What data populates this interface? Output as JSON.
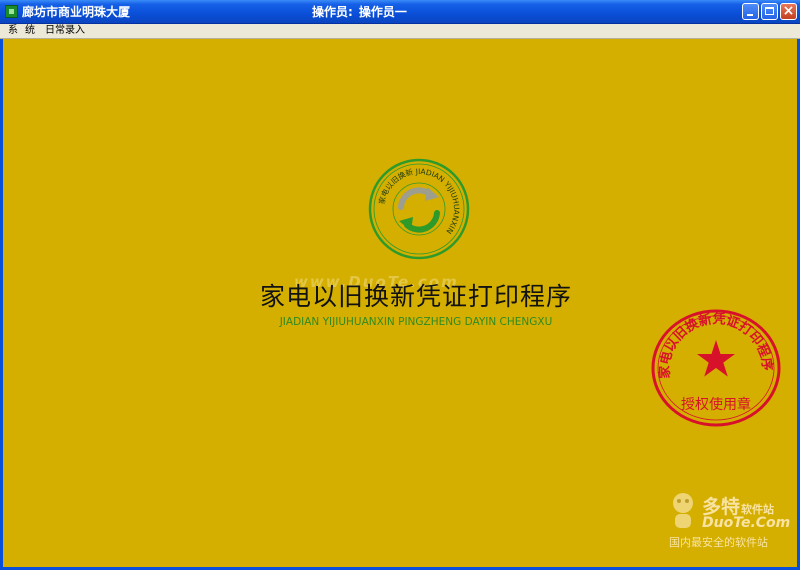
{
  "window": {
    "title": "廊坊市商业明珠大厦",
    "operator_label": "操作员:",
    "operator_name": "操作员一",
    "buttons": [
      "minimize",
      "maximize",
      "close"
    ]
  },
  "menu": {
    "items": [
      {
        "label": "系统"
      },
      {
        "label": "日常录入"
      }
    ]
  },
  "splash": {
    "logo_ring_text": "家电以旧换新 JIADIAN YIJIUHUANXIN",
    "logo_icon": "recycle-arrows-icon",
    "title": "家电以旧换新凭证打印程序",
    "subtitle": "JIADIAN YIJIUHUANXIN PINGZHENG DAYIN CHENGXU",
    "watermark": "www.DuoTe.com"
  },
  "seal": {
    "arc_text": "家电以旧换新凭证打印程序",
    "bottom_text": "授权使用章",
    "icon": "star-icon"
  },
  "corner_watermark": {
    "name": "多特",
    "name_suffix": "软件站",
    "domain": "DuoTe.Com",
    "slogan": "国内最安全的软件站"
  },
  "colors": {
    "background": "#d4af00",
    "titlebar": "#0a4fd8",
    "logo_green": "#2e9a2a",
    "seal_red": "#d8112a"
  }
}
